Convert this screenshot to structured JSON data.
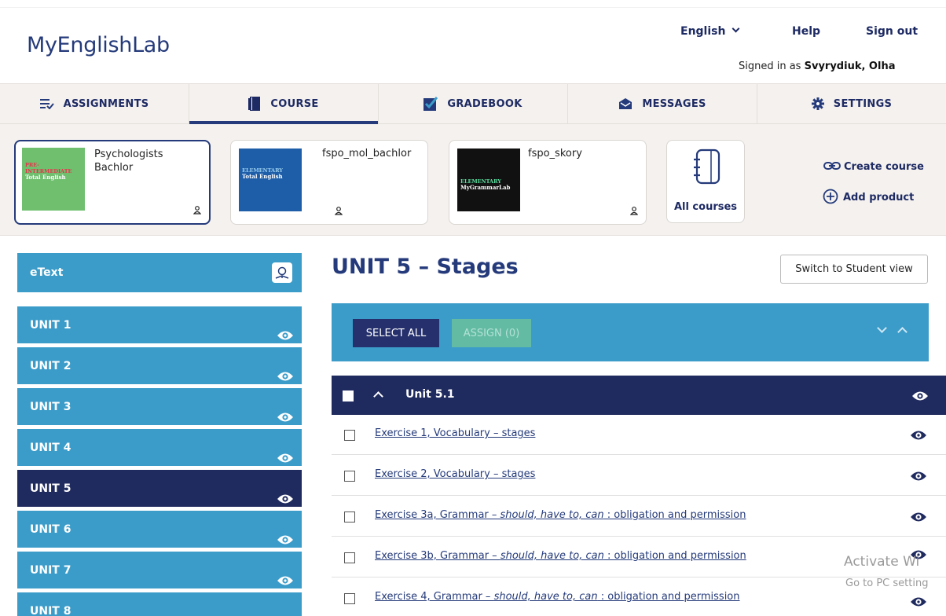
{
  "header": {
    "logo": "MyEnglishLab",
    "language": "English",
    "help": "Help",
    "sign_out": "Sign out",
    "signed_in_prefix": "Signed in as",
    "user_name": "Svyrydiuk, Olha"
  },
  "nav": {
    "tabs": [
      {
        "label": "ASSIGNMENTS",
        "icon": "assignments-icon"
      },
      {
        "label": "COURSE",
        "icon": "book-icon",
        "active": true
      },
      {
        "label": "GRADEBOOK",
        "icon": "gradebook-check-icon"
      },
      {
        "label": "MESSAGES",
        "icon": "envelope-icon"
      },
      {
        "label": "SETTINGS",
        "icon": "gear-icon"
      }
    ]
  },
  "courses": [
    {
      "title": "Psychologists Bachlor",
      "cover_line1": "PRE-",
      "cover_line2": "INTERMEDIATE",
      "cover_brand": "Total English",
      "cover_color": "#6fbf6f"
    },
    {
      "title": "fspo_mol_bachlor",
      "cover_line1": "ELEMENTARY",
      "cover_brand": "Total English",
      "cover_color": "#1e5ea8"
    },
    {
      "title": "fspo_skory",
      "cover_line1": "ELEMENTARY",
      "cover_brand": "MyGrammarLab",
      "cover_color": "#111111"
    }
  ],
  "all_courses": "All courses",
  "actions": {
    "create_course": "Create course",
    "add_product": "Add product"
  },
  "sidebar": {
    "etext": "eText",
    "units": [
      "UNIT 1",
      "UNIT 2",
      "UNIT 3",
      "UNIT 4",
      "UNIT 5",
      "UNIT 6",
      "UNIT 7",
      "UNIT 8"
    ],
    "active_unit": "UNIT 5"
  },
  "main": {
    "title": "UNIT 5 – Stages",
    "switch_view": "Switch to Student view",
    "select_all": "SELECT ALL",
    "assign": "ASSIGN (0)",
    "section": "Unit 5.1",
    "exercises": [
      {
        "prefix": "Exercise 1, Vocabulary – stages",
        "italic": "",
        "suffix": ""
      },
      {
        "prefix": "Exercise 2, Vocabulary – stages",
        "italic": "",
        "suffix": ""
      },
      {
        "prefix": "Exercise 3a, Grammar – ",
        "italic": "should, have to, can",
        "suffix": " : obligation and permission"
      },
      {
        "prefix": "Exercise 3b, Grammar – ",
        "italic": "should, have to, can",
        "suffix": " : obligation and permission"
      },
      {
        "prefix": "Exercise 4, Grammar – ",
        "italic": "should, have to, can",
        "suffix": " : obligation and permission"
      }
    ]
  },
  "watermark": {
    "line1": "Activate Wi",
    "line2": "Go to PC setting"
  },
  "colors": {
    "brand_navy": "#1f2a5e",
    "teal": "#3b9cc9",
    "green_button": "#67bf9e"
  }
}
